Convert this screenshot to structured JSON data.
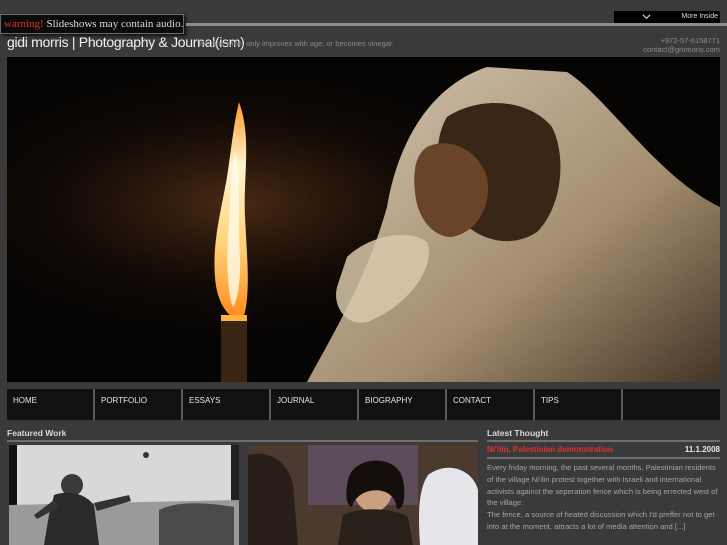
{
  "banner": {
    "warning_label": "warning!",
    "warning_text": " Slideshows may contain audio..."
  },
  "more_inside": {
    "label": "More Inside",
    "icon": "chevron-down-icon"
  },
  "header": {
    "site_title": "gidi morris | Photography & Journal(ism)",
    "tagline": "like fine wine, only improves with age, or becomes vinegar.",
    "phone": "+972-57-6158771",
    "email": "contact@gmmoris.com"
  },
  "nav": {
    "items": [
      "HOME",
      "PORTFOLIO",
      "ESSAYS",
      "JOURNAL",
      "BIOGRAPHY",
      "CONTACT",
      "TIPS"
    ]
  },
  "featured": {
    "heading": "Featured Work"
  },
  "latest": {
    "heading": "Latest Thought",
    "post_title": "Ni'ilin, Palestinian demonstration",
    "post_date": "11.1.2008",
    "paragraph_1": "Every friday morning, the past several months, Palestinian residents of the village Ni'ilin protest together with Israeli and international activists against the seperation fence which is being errected west of the village.",
    "paragraph_2": "The fence, a source of heated discussion which I'd preffer not to get into at the moment, attracts a lot of media attention and [...]"
  },
  "colors": {
    "background": "#3a3a3a",
    "accent_red": "#e0302a",
    "nav_bg": "#111111"
  }
}
